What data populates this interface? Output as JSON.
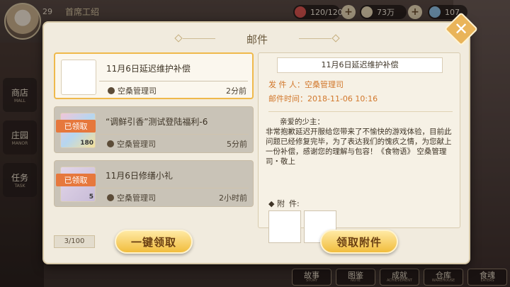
{
  "topbar": {
    "level": "29",
    "player_name": "首席工绍",
    "stamina": "120/120",
    "coins": "73万",
    "gems": "107"
  },
  "side_nav": [
    {
      "label": "商店",
      "sub": "MALL"
    },
    {
      "label": "庄园",
      "sub": "MANOR"
    },
    {
      "label": "任务",
      "sub": "TASK"
    }
  ],
  "bottom_nav": [
    {
      "label": "故事",
      "sub": "STORY"
    },
    {
      "label": "图鉴",
      "sub": "NOTE"
    },
    {
      "label": "成就",
      "sub": "ACHIEVEMENT"
    },
    {
      "label": "仓库",
      "sub": "WAREHOUSE"
    },
    {
      "label": "食魂",
      "sub": "EATERS"
    }
  ],
  "dialog": {
    "title": "邮件",
    "mails": [
      {
        "subject": "11月6日延迟维护补偿",
        "sender": "空桑管理司",
        "time": "2分前",
        "claimed": "",
        "qty": ""
      },
      {
        "subject": "“调鲜引香”测试登陆福利-6",
        "sender": "空桑管理司",
        "time": "5分前",
        "claimed": "已领取",
        "qty": "180"
      },
      {
        "subject": "11月6日修缮小礼",
        "sender": "空桑管理司",
        "time": "2小时前",
        "claimed": "已领取",
        "qty": "5"
      }
    ],
    "detail": {
      "title": "11月6日延迟维护补偿",
      "sender_label": "发 件 人：",
      "sender": "空桑管理司",
      "time_label": "邮件时间：",
      "time": "2018-11-06  10:16",
      "greeting": "亲爱的少主：",
      "body": "非常抱歉延迟开服给您带来了不愉快的游戏体验，目前此问题已经修复完毕，为了表达我们的愧疚之情，为您献上一份补偿，感谢您的理解与包容！《食物语》 空桑管理司・敬上",
      "attach_label_a": "◆ 附",
      "attach_label_b": "件:"
    },
    "counter": "3/100",
    "claim_all_label": "一键领取",
    "claim_attach_label": "领取附件"
  }
}
